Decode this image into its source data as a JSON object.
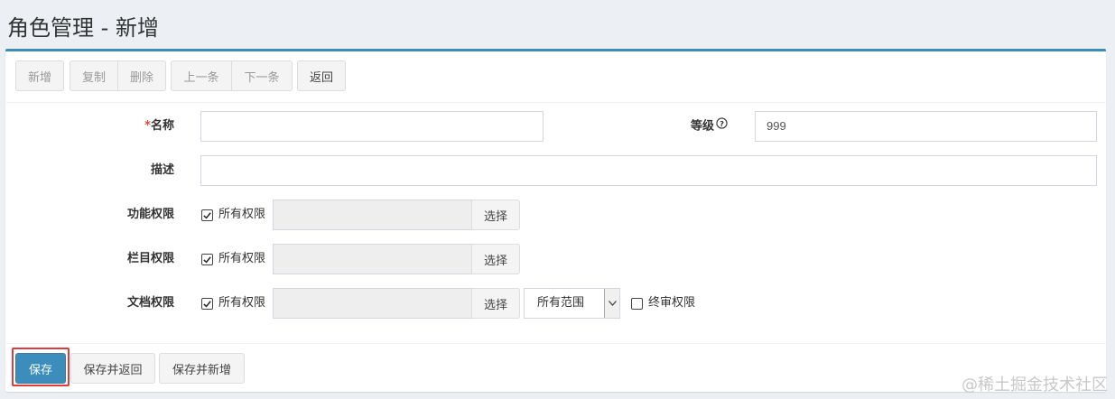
{
  "page": {
    "title": "角色管理 - 新增"
  },
  "toolbar": {
    "new_label": "新增",
    "copy_label": "复制",
    "delete_label": "删除",
    "prev_label": "上一条",
    "next_label": "下一条",
    "back_label": "返回"
  },
  "form": {
    "name": {
      "required_mark": "*",
      "label": "名称",
      "value": ""
    },
    "level": {
      "label": "等级",
      "help_icon": "question-circle-icon",
      "value": "999"
    },
    "description": {
      "label": "描述",
      "value": ""
    },
    "function_perm": {
      "label": "功能权限",
      "checkbox_label": "所有权限",
      "checked": true,
      "value": "",
      "select_label": "选择"
    },
    "column_perm": {
      "label": "栏目权限",
      "checkbox_label": "所有权限",
      "checked": true,
      "value": "",
      "select_label": "选择"
    },
    "document_perm": {
      "label": "文档权限",
      "checkbox_label": "所有权限",
      "checked": true,
      "value": "",
      "select_label": "选择",
      "scope_selected": "所有范围",
      "final_review_label": "终审权限",
      "final_review_checked": false
    }
  },
  "footer": {
    "save_label": "保存",
    "save_back_label": "保存并返回",
    "save_new_label": "保存并新增"
  },
  "watermark": "@稀土掘金技术社区",
  "colors": {
    "accent": "#3c8dbc",
    "highlight": "#e03c3c",
    "required": "#dd4b39"
  }
}
